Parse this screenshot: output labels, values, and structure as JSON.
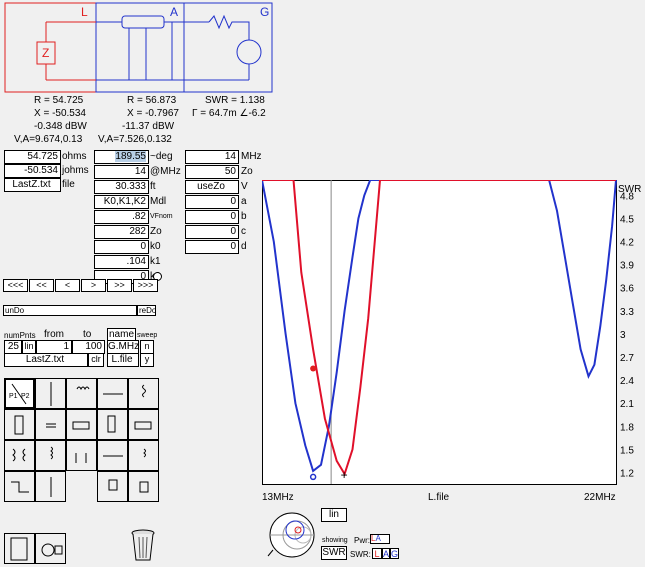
{
  "schematic": {
    "load_label": "L",
    "line_label": "A",
    "gen_label": "G",
    "load_symbol": "Z"
  },
  "readouts": {
    "load": {
      "r": "R = 54.725",
      "x": "X = -50.534",
      "dbw": "-0.348 dBW",
      "va": "V,A=9.674,0.13"
    },
    "line": {
      "r": "R = 56.873",
      "x": "X = -0.7967",
      "dbw": "-11.37 dBW",
      "va": "V,A=7.526,0.132"
    },
    "gen": {
      "swr": "SWR = 1.138",
      "gamma": "Γ = 64.7m ∠-6.2"
    }
  },
  "load_panel": {
    "r_value": "54.725",
    "r_unit": "ohms",
    "x_value": "-50.534",
    "x_unit": "johms",
    "file_value": "LastZ.txt",
    "file_unit": "file"
  },
  "line_panel": {
    "rows": [
      {
        "value": "189.55",
        "unit": "~deg"
      },
      {
        "value": "14",
        "unit": "@MHz"
      },
      {
        "value": "30.333",
        "unit": "ft"
      },
      {
        "value": "K0,K1,K2",
        "unit": "Mdl"
      },
      {
        "value": ".82",
        "unit": "VFnom"
      },
      {
        "value": "282",
        "unit": "Zo"
      },
      {
        "value": "0",
        "unit": "k0"
      },
      {
        "value": ".104",
        "unit": "k1"
      },
      {
        "value": "0",
        "unit": "k2"
      }
    ]
  },
  "gen_panel": {
    "rows": [
      {
        "value": "14",
        "unit": "MHz"
      },
      {
        "value": "50",
        "unit": "Zo"
      },
      {
        "value": "useZo",
        "unit": "V"
      },
      {
        "value": "0",
        "unit": "a"
      },
      {
        "value": "0",
        "unit": "b"
      },
      {
        "value": "0",
        "unit": "c"
      },
      {
        "value": "0",
        "unit": "d"
      }
    ]
  },
  "nav_buttons": [
    "<<<",
    "<<",
    "<",
    ">",
    ">>",
    ">>>"
  ],
  "undo": {
    "left": "unDo",
    "right": "reDo"
  },
  "sweep": {
    "hdr_numpnts": "numPnts",
    "hdr_from": "from",
    "hdr_to": "to",
    "hdr_name": "name",
    "hdr_sweep": "sweep",
    "numpnts": "25",
    "scale": "lin",
    "from": "1",
    "to": "100",
    "name": "G.MHz",
    "n": "n",
    "file": "LastZ.txt",
    "clr": "clr",
    "lfile": "L.file",
    "y": "y"
  },
  "chart_data": {
    "type": "line",
    "xlabel": "L.file",
    "x_ticks": [
      "13MHz",
      "22MHz"
    ],
    "ylabel": "SWR",
    "y_ticks": [
      "4.8",
      "4.5",
      "4.2",
      "3.9",
      "3.6",
      "3.3",
      "3",
      "2.7",
      "2.4",
      "2.1",
      "1.8",
      "1.5",
      "1.2"
    ],
    "ylim": [
      1.05,
      5.0
    ],
    "xlim": [
      13,
      22
    ],
    "series": [
      {
        "color": "#2233cc",
        "x": [
          13.0,
          13.3,
          13.6,
          13.85,
          14.1,
          14.3,
          14.5,
          14.7,
          14.9,
          15.1,
          15.3,
          15.45,
          15.6,
          15.75,
          15.9,
          16.0,
          16.1,
          20.3,
          20.5,
          20.7,
          20.9,
          21.1,
          21.3,
          21.45,
          21.6,
          21.75,
          21.9,
          22.0
        ],
        "y": [
          5.0,
          4.2,
          3.0,
          2.1,
          1.55,
          1.22,
          1.3,
          1.8,
          2.5,
          3.3,
          4.0,
          4.5,
          4.8,
          5.0,
          5.0,
          5.0,
          5.0,
          5.0,
          4.6,
          4.0,
          3.4,
          2.8,
          2.45,
          2.6,
          3.1,
          3.7,
          4.4,
          5.0
        ]
      },
      {
        "color": "#e0102a",
        "x": [
          13.0,
          13.8,
          14.0,
          14.3,
          14.6,
          14.9,
          15.1,
          15.3,
          15.5,
          15.7,
          15.85,
          16.0,
          22.0
        ],
        "y": [
          5.0,
          5.0,
          3.8,
          2.8,
          1.9,
          1.35,
          1.18,
          1.5,
          2.3,
          3.2,
          4.1,
          5.0,
          5.0
        ]
      }
    ],
    "marker_x": 14.3
  },
  "bottom": {
    "lin": "lin",
    "showing": "showing",
    "swr_btn": "SWR",
    "pwr_label": "Pwr:",
    "swr_label": "SWR:",
    "l": "L",
    "a": "A",
    "g": "G"
  }
}
